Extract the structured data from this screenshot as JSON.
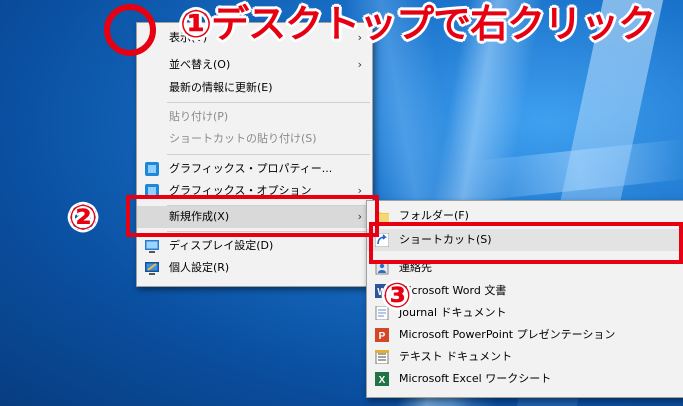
{
  "annotations": {
    "step1_title": "①デスクトップで右クリック",
    "step2": "②",
    "step3": "③"
  },
  "context_menu": {
    "items": [
      {
        "label": "表示(V)",
        "submenu": true
      },
      {
        "label": "並べ替え(O)",
        "submenu": true
      },
      {
        "label": "最新の情報に更新(E)"
      },
      {
        "label": "貼り付け(P)",
        "disabled": true
      },
      {
        "label": "ショートカットの貼り付け(S)",
        "disabled": true
      },
      {
        "label": "グラフィックス・プロパティー...",
        "icon": "intel-graphics-icon"
      },
      {
        "label": "グラフィックス・オプション",
        "icon": "intel-graphics-icon",
        "submenu": true
      },
      {
        "label": "新規作成(X)",
        "submenu": true,
        "highlighted": true
      },
      {
        "label": "ディスプレイ設定(D)",
        "icon": "display-settings-icon"
      },
      {
        "label": "個人設定(R)",
        "icon": "personalize-icon"
      }
    ]
  },
  "new_submenu": {
    "items": [
      {
        "label": "フォルダー(F)",
        "icon": "folder-icon"
      },
      {
        "label": "ショートカット(S)",
        "icon": "shortcut-icon",
        "highlighted": true
      },
      {
        "label": "連絡先",
        "icon": "contact-icon"
      },
      {
        "label": "Microsoft Word 文書",
        "icon": "word-icon"
      },
      {
        "label": "Journal ドキュメント",
        "icon": "journal-icon"
      },
      {
        "label": "Microsoft PowerPoint プレゼンテーション",
        "icon": "powerpoint-icon"
      },
      {
        "label": "テキスト ドキュメント",
        "icon": "text-document-icon"
      },
      {
        "label": "Microsoft Excel ワークシート",
        "icon": "excel-icon"
      }
    ]
  },
  "colors": {
    "accent_red": "#e60012",
    "menu_bg": "#f2f2f2",
    "highlight": "#d9d9d9"
  }
}
